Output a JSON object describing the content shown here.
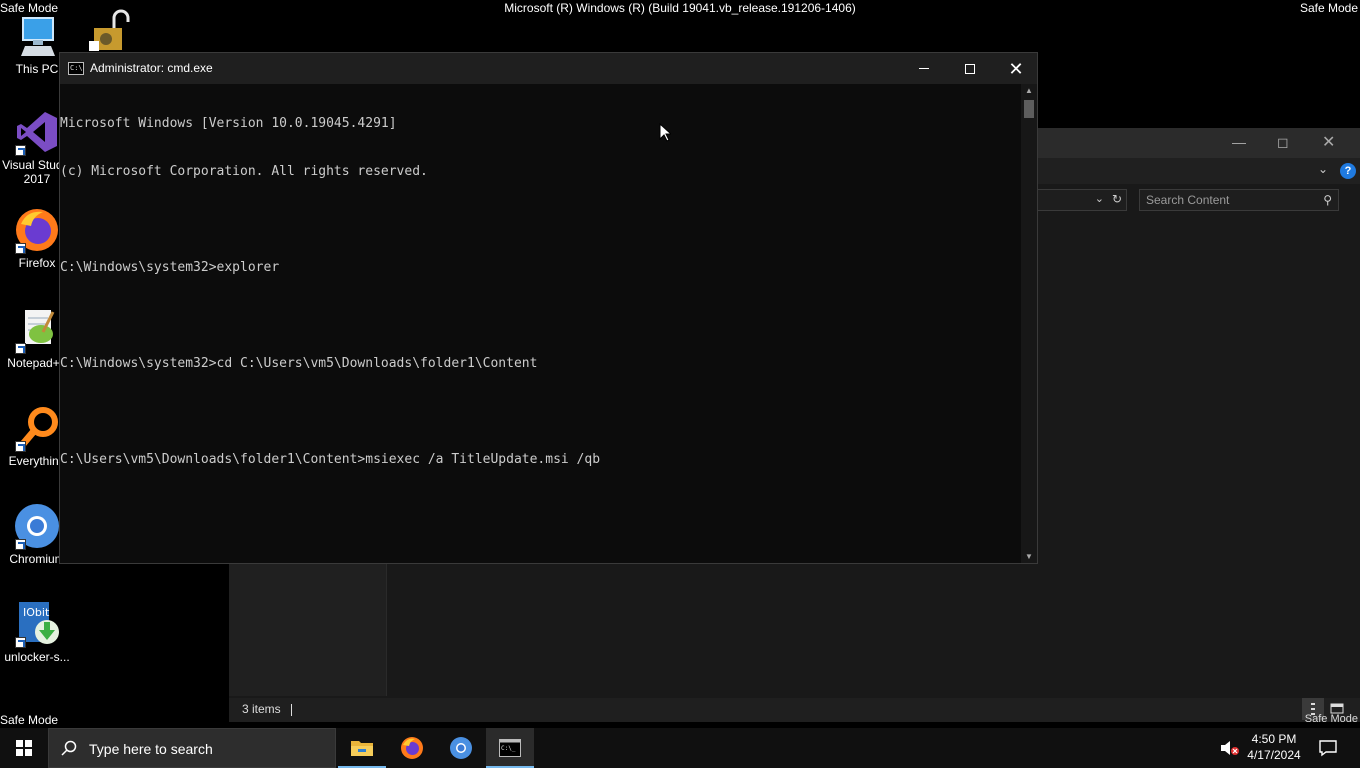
{
  "safe_mode": {
    "top_left": "Safe Mode",
    "top_right": "Safe Mode",
    "bottom_left": "Safe Mode",
    "bottom_right": "Safe Mode",
    "build": "Microsoft (R) Windows (R) (Build 19041.vb_release.191206-1406)"
  },
  "desktop": {
    "icons": [
      {
        "name": "this-pc",
        "label": "This PC"
      },
      {
        "name": "visual-studio",
        "label": "Visual Studio",
        "label2": "2017"
      },
      {
        "name": "firefox",
        "label": "Firefox"
      },
      {
        "name": "notepadpp",
        "label": "Notepad++"
      },
      {
        "name": "everything",
        "label": "Everything"
      },
      {
        "name": "chromium",
        "label": "Chromium"
      },
      {
        "name": "unlocker",
        "label": "unlocker-s..."
      }
    ]
  },
  "cmd": {
    "title": "Administrator: cmd.exe",
    "icon_text": "C:\\",
    "lines": [
      "Microsoft Windows [Version 10.0.19045.4291]",
      "(c) Microsoft Corporation. All rights reserved.",
      "",
      "C:\\Windows\\system32>explorer",
      "",
      "C:\\Windows\\system32>cd C:\\Users\\vm5\\Downloads\\folder1\\Content",
      "",
      "C:\\Users\\vm5\\Downloads\\folder1\\Content>msiexec /a TitleUpdate.msi /qb"
    ]
  },
  "explorer": {
    "search_placeholder": "Search Content",
    "status": "3 items",
    "help": "?"
  },
  "taskbar": {
    "search_placeholder": "Type here to search",
    "time": "4:50 PM",
    "date": "4/17/2024"
  },
  "colors": {
    "taskbar_bg": "#101010",
    "accent_underline": "#76b9ed",
    "cmd_text": "#cccccc"
  }
}
